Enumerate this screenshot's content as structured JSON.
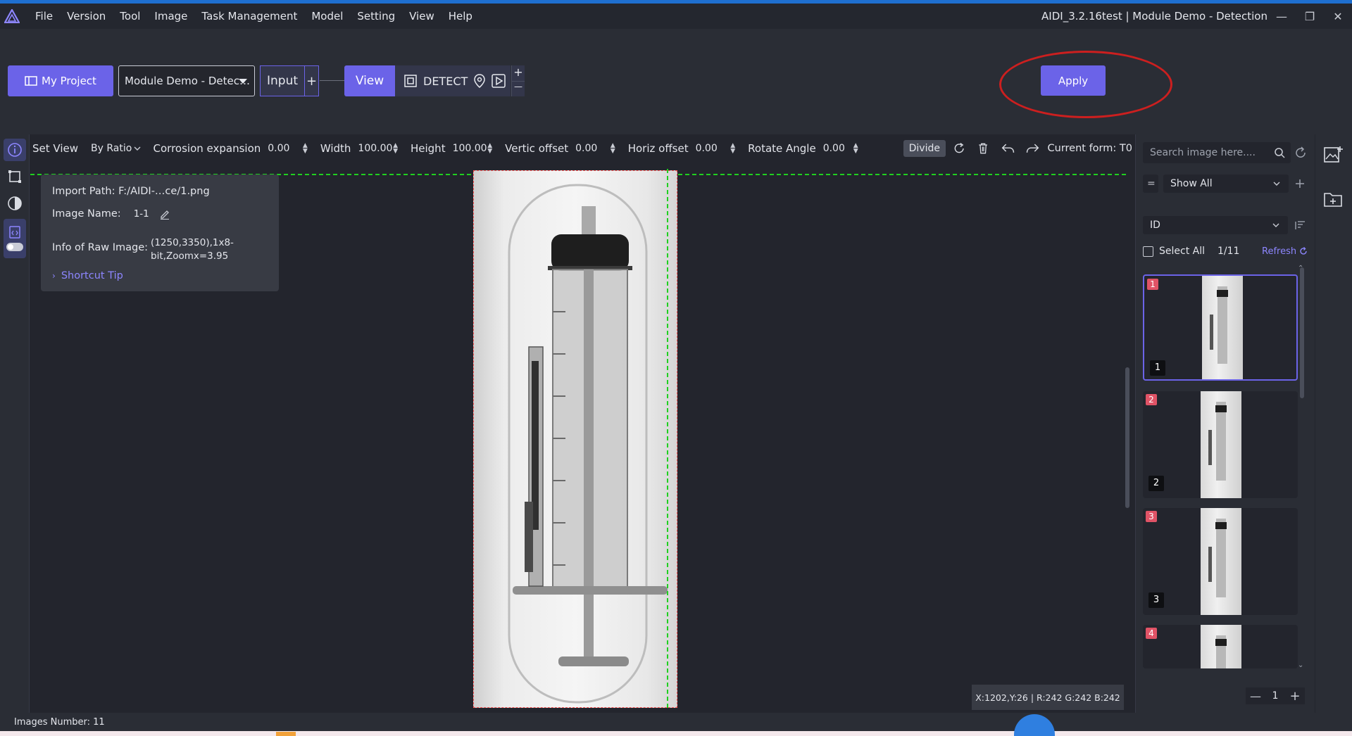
{
  "window": {
    "title": "AIDI_3.2.16test | Module Demo - Detection",
    "minimize_glyph": "—",
    "maximize_glyph": "❐",
    "close_glyph": "✕"
  },
  "menu": [
    "File",
    "Version",
    "Tool",
    "Image",
    "Task Management",
    "Model",
    "Setting",
    "View",
    "Help"
  ],
  "toolbar": {
    "my_project_label": "My Project",
    "module_select_value": "Module Demo - Detec…",
    "input_label": "Input",
    "view_label": "View",
    "detect_label": "DETECT",
    "apply_label": "Apply",
    "plus_glyph": "+",
    "minus_glyph": "—"
  },
  "options": {
    "set_view_label": "Set View",
    "by_ratio_value": "By Ratio",
    "corrosion_label": "Corrosion expansion",
    "corrosion_value": "0.00",
    "width_label": "Width",
    "width_value": "100.00",
    "height_label": "Height",
    "height_value": "100.00",
    "vertic_label": "Vertic offset",
    "vertic_value": "0.00",
    "horiz_label": "Horiz offset",
    "horiz_value": "0.00",
    "rotate_label": "Rotate Angle",
    "rotate_value": "0.00",
    "divide_label": "Divide",
    "current_form": "Current form: T0"
  },
  "info_card": {
    "import_path": "Import Path: F:/AIDI-…ce/1.png",
    "image_name_label": "Image Name:",
    "image_name_value": "1-1",
    "raw_info_label": "Info of Raw Image:",
    "raw_info_line1": "(1250,3350),1x8-",
    "raw_info_line2": "bit,Zoomx=3.95",
    "shortcut_tip": "Shortcut Tip"
  },
  "right_panel": {
    "search_placeholder": "Search image here....",
    "filter_eq": "=",
    "show_all_value": "Show All",
    "sort_value": "ID",
    "select_all_label": "Select All",
    "select_count": "1/11",
    "refresh_label": "Refresh",
    "thumbnails": [
      {
        "id": "1",
        "label": "1"
      },
      {
        "id": "2",
        "label": "2"
      },
      {
        "id": "3",
        "label": "3"
      },
      {
        "id": "4",
        "label": ""
      }
    ],
    "page_value": "1"
  },
  "coord_readout": "X:1202,Y:26 | R:242 G:242 B:242",
  "status": {
    "images_number": "Images Number: 11"
  },
  "colors": {
    "accent": "#6b63e8",
    "annotation_circle": "#cc1f1f",
    "roi_line": "#20d020",
    "badge_red": "#e05366"
  }
}
